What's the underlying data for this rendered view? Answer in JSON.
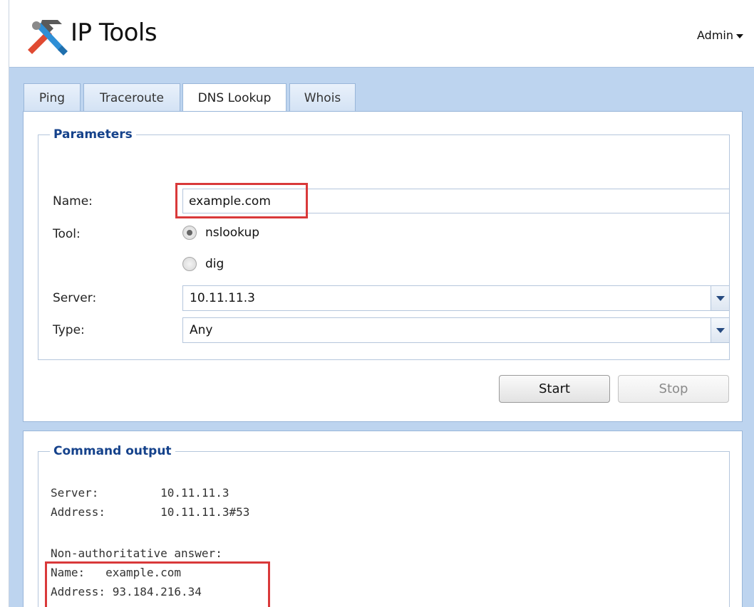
{
  "app": {
    "title": "IP Tools",
    "user_menu": "Admin"
  },
  "tabs": [
    {
      "label": "Ping",
      "active": false
    },
    {
      "label": "Traceroute",
      "active": false
    },
    {
      "label": "DNS Lookup",
      "active": true
    },
    {
      "label": "Whois",
      "active": false
    }
  ],
  "parameters": {
    "legend": "Parameters",
    "name_label": "Name:",
    "name_value": "example.com",
    "tool_label": "Tool:",
    "tool_options": [
      {
        "label": "nslookup",
        "checked": true
      },
      {
        "label": "dig",
        "checked": false
      }
    ],
    "server_label": "Server:",
    "server_value": "10.11.11.3",
    "type_label": "Type:",
    "type_value": "Any"
  },
  "buttons": {
    "start": "Start",
    "stop": "Stop"
  },
  "output": {
    "legend": "Command output",
    "lines": [
      "Server:         10.11.11.3",
      "Address:        10.11.11.3#53",
      "",
      "Non-authoritative answer:",
      "Name:   example.com",
      "Address: 93.184.216.34"
    ]
  },
  "colors": {
    "accent_blue": "#15428b",
    "highlight_red": "#d9393a",
    "panel_bg": "#bdd4ef"
  }
}
